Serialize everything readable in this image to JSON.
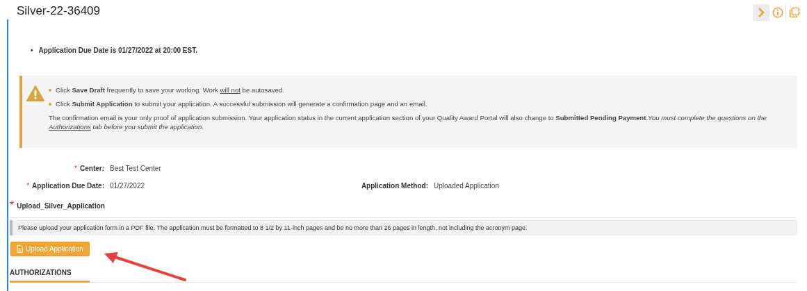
{
  "title": "Silver-22-36409",
  "toolbar": [
    {
      "kind": "chevron",
      "selected": true
    },
    {
      "kind": "info",
      "selected": false
    },
    {
      "kind": "copy",
      "selected": false
    }
  ],
  "due_notice": {
    "bullet": "•",
    "text": "Application Due Date is 01/27/2022 at 20:00 EST."
  },
  "warning": {
    "bullets": [
      [
        {
          "kind": "plain",
          "text": "Click "
        },
        {
          "kind": "bold",
          "text": "Save Draft"
        },
        {
          "kind": "plain",
          "text": " frequently to save your working. Work "
        },
        {
          "kind": "underline",
          "text": "will not"
        },
        {
          "kind": "plain",
          "text": " be autosaved."
        }
      ],
      [
        {
          "kind": "plain",
          "text": "Click "
        },
        {
          "kind": "bold",
          "text": "Submit Application"
        },
        {
          "kind": "plain",
          "text": " to submit your application. A successful submission will generate a confirmation page and an email."
        }
      ]
    ],
    "paragraph": [
      {
        "kind": "plain",
        "text": "The confirmation email is your only proof of application submission. Your application status in the current application section of your Quality Award Portal will also change to "
      },
      {
        "kind": "bold",
        "text": "Submitted Pending Payment"
      },
      {
        "kind": "plain",
        "text": "."
      },
      {
        "kind": "italic",
        "text": "You must complete the questions on the "
      },
      {
        "kind": "italic-underline",
        "text": "Authorizations"
      },
      {
        "kind": "italic",
        "text": " tab before you submit the application."
      }
    ]
  },
  "fields": [
    {
      "label": "Center:",
      "value": "Best Test Center",
      "required_mark": "*"
    },
    {
      "label": "Application Due Date:",
      "value": "01/27/2022",
      "required_mark": "*",
      "extra_label": "Application Method:",
      "extra_value": "Uploaded Application"
    }
  ],
  "upload": {
    "label": "Upload_Silver_Application",
    "required_mark": "*",
    "info": "Please upload your application form in a PDF file. The application must be formatted to 8 1/2 by 11-inch pages and be no more than 26 pages in length, not including the acronym page.",
    "button": "Upload Application"
  },
  "tabs": [
    {
      "label": "AUTHORIZATIONS",
      "selected": true
    }
  ]
}
